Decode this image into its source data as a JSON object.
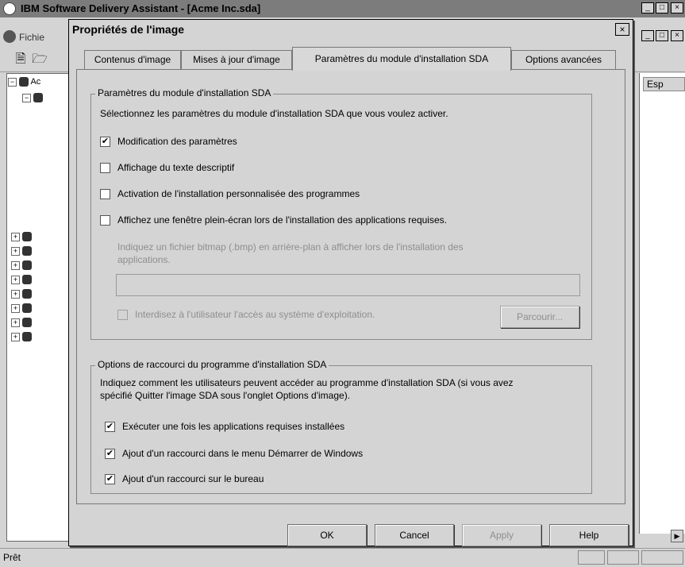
{
  "main_window": {
    "title": "IBM Software Delivery Assistant - [Acme Inc.sda]",
    "menu_file": "Fichie",
    "right_column_header": "Esp",
    "status": "Prêt",
    "tree_root_label": "Ac",
    "window_controls": [
      "_",
      "□",
      "×"
    ]
  },
  "dialog": {
    "title": "Propriétés de l'image",
    "close_glyph": "×",
    "tabs": [
      {
        "label": "Contenus d'image",
        "active": false
      },
      {
        "label": "Mises à jour d'image",
        "active": false
      },
      {
        "label": "Paramètres du module d'installation SDA",
        "active": true
      },
      {
        "label": "Options avancées",
        "active": false
      }
    ],
    "group1": {
      "legend": "Paramètres du module d'installation SDA",
      "description": "Sélectionnez les paramètres du module d'installation SDA que vous voulez activer.",
      "options": [
        {
          "label": "Modification des paramètres",
          "checked": true
        },
        {
          "label": "Affichage du texte descriptif",
          "checked": false
        },
        {
          "label": "Activation de l'installation personnalisée des programmes",
          "checked": false
        },
        {
          "label": "Affichez une fenêtre plein-écran lors de l'installation des applications requises.",
          "checked": false
        }
      ],
      "bitmap_hint_line1": "Indiquez un fichier bitmap (.bmp) en arrière-plan à afficher lors de l'installation des",
      "bitmap_hint_line2": "applications.",
      "bitmap_value": "",
      "restrict_label": "Interdisez à l'utilisateur l'accès au système d'exploitation.",
      "restrict_checked": false,
      "browse_label": "Parcourir..."
    },
    "group2": {
      "legend": "Options de raccourci du programme d'installation SDA",
      "description_line1": "Indiquez comment les utilisateurs peuvent accéder au programme d'installation SDA (si vous avez",
      "description_line2": "spécifié Quitter l'image SDA sous l'onglet Options d'image).",
      "options": [
        {
          "label": "Exécuter une fois les applications requises installées",
          "checked": true
        },
        {
          "label": "Ajout d'un raccourci dans le menu Démarrer de Windows",
          "checked": true
        },
        {
          "label": "Ajout d'un raccourci sur le bureau",
          "checked": true
        }
      ]
    },
    "buttons": {
      "ok": "OK",
      "cancel": "Cancel",
      "apply": "Apply",
      "help": "Help"
    },
    "check_glyph": "✔"
  }
}
